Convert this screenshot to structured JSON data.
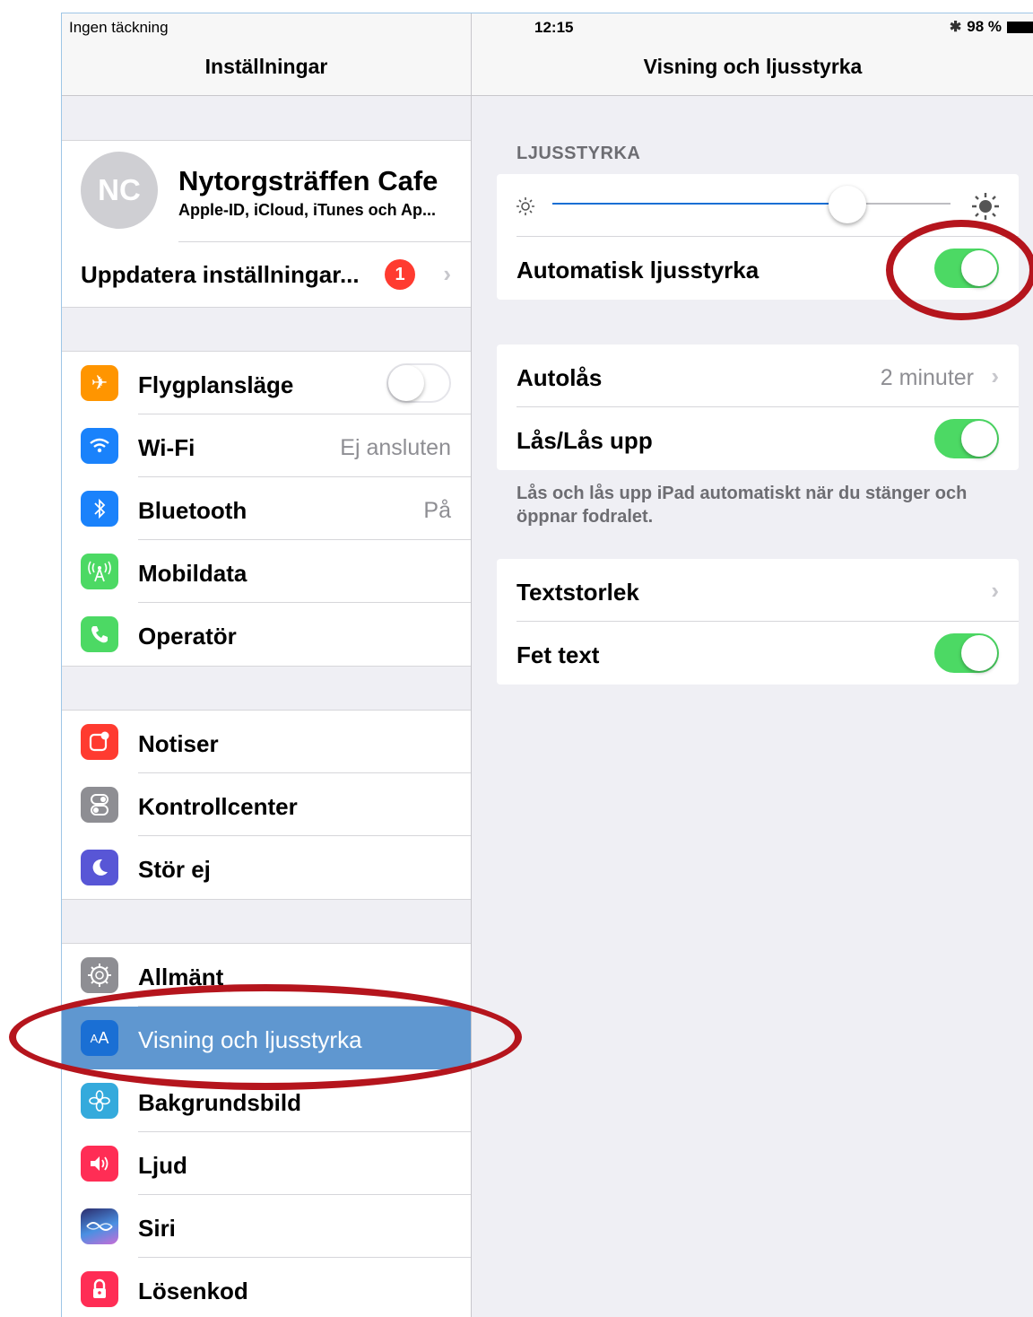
{
  "status_bar": {
    "carrier": "Ingen täckning",
    "time": "12:15",
    "battery": "98 %"
  },
  "master": {
    "title": "Inställningar",
    "profile": {
      "initials": "NC",
      "name": "Nytorgsträffen Cafe",
      "subtitle": "Apple-ID, iCloud, iTunes och Ap..."
    },
    "update": {
      "label": "Uppdatera inställningar...",
      "badge": "1"
    },
    "connectivity": [
      {
        "label": "Flygplansläge",
        "icon": "airplane-icon",
        "color": "#ff9500",
        "toggle": "off"
      },
      {
        "label": "Wi-Fi",
        "value": "Ej ansluten",
        "icon": "wifi-icon",
        "color": "#1a82fb"
      },
      {
        "label": "Bluetooth",
        "value": "På",
        "icon": "bluetooth-icon",
        "color": "#1a82fb"
      },
      {
        "label": "Mobildata",
        "icon": "cellular-icon",
        "color": "#4cd964"
      },
      {
        "label": "Operatör",
        "icon": "phone-icon",
        "color": "#4cd964"
      }
    ],
    "notifications": [
      {
        "label": "Notiser",
        "icon": "notifications-icon",
        "color": "#ff3b30"
      },
      {
        "label": "Kontrollcenter",
        "icon": "control-center-icon",
        "color": "#8e8e93"
      },
      {
        "label": "Stör ej",
        "icon": "moon-icon",
        "color": "#5856d6"
      }
    ],
    "general": [
      {
        "label": "Allmänt",
        "icon": "gear-icon",
        "color": "#8e8e93"
      },
      {
        "label": "Visning och ljusstyrka",
        "icon": "display-text-icon",
        "color": "#1a6fd4",
        "selected": true
      },
      {
        "label": "Bakgrundsbild",
        "icon": "wallpaper-flower-icon",
        "color": "#34aadc"
      },
      {
        "label": "Ljud",
        "icon": "speaker-icon",
        "color": "#ff2d55"
      },
      {
        "label": "Siri",
        "icon": "siri-icon",
        "color": "#222244"
      },
      {
        "label": "Lösenkod",
        "icon": "lock-icon",
        "color": "#ff2d55"
      }
    ]
  },
  "detail": {
    "title": "Visning och ljusstyrka",
    "brightness_header": "LJUSSTYRKA",
    "brightness_level": 0.74,
    "auto_brightness": {
      "label": "Automatisk ljusstyrka",
      "toggle": "on"
    },
    "autolock": {
      "label": "Autolås",
      "value": "2 minuter"
    },
    "lock_unlock": {
      "label": "Lås/Lås upp",
      "toggle": "on"
    },
    "lock_footer": "Lås och lås upp iPad automatiskt när du stänger och öppnar fodralet.",
    "text_size": {
      "label": "Textstorlek"
    },
    "bold_text": {
      "label": "Fet text",
      "toggle": "on"
    }
  },
  "colors": {
    "toggle_on": "#4cd964",
    "selection": "#5f97d0",
    "annotation": "#b5151d"
  }
}
